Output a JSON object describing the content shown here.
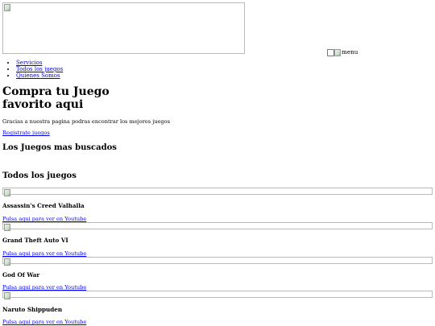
{
  "header": {
    "menu_alt": "menu"
  },
  "nav": {
    "items": [
      "Servicios",
      "Todos los juegos",
      "Quienes Somos"
    ]
  },
  "hero": {
    "title_line1": "Compra tu Juego",
    "title_line2": "favorito aqui",
    "subtitle": "Gracias a nuestra pagina podras encontrar los mejores juegos",
    "register_label": "Registrate juegos"
  },
  "sections": {
    "most_searched": "Los Juegos mas buscados",
    "all_games": "Todos los juegos"
  },
  "games": [
    {
      "title": "Assassin's Creed Valhalla",
      "link": "Pulsa aqui para ver en Youtube"
    },
    {
      "title": "Grand Theft Auto VI",
      "link": "Pulsa aqui para ver en Youtube"
    },
    {
      "title": "God Of War",
      "link": "Pulsa aqui para ver en Youtube"
    },
    {
      "title": "Naruto Shippuden",
      "link": "Pulsa aqui para ver en Youtube"
    }
  ]
}
